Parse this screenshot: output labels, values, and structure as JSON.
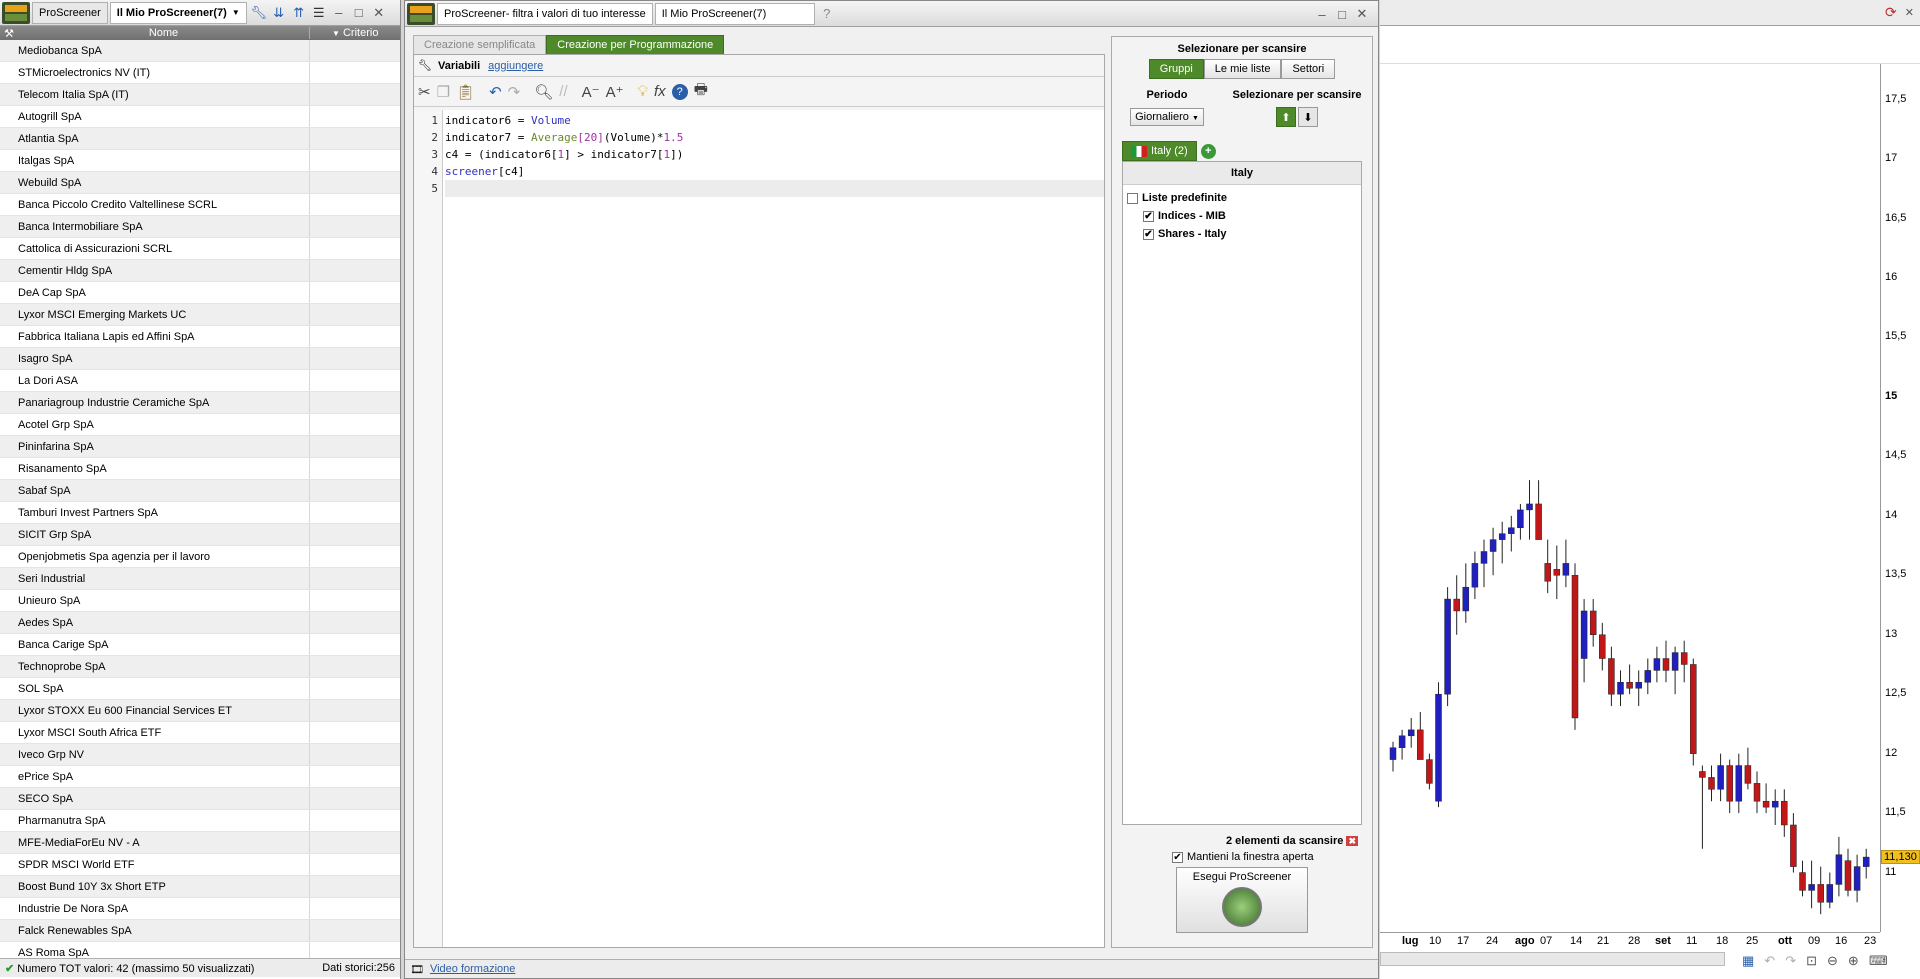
{
  "left_panel": {
    "tabs": [
      "ProScreener",
      "Il Mio ProScreener(7)"
    ],
    "columns": {
      "name": "Nome",
      "criterion": "Criterio"
    },
    "rows": [
      "Mediobanca SpA",
      "STMicroelectronics NV (IT)",
      "Telecom Italia SpA (IT)",
      "Autogrill SpA",
      "Atlantia SpA",
      "Italgas SpA",
      "Webuild SpA",
      "Banca Piccolo Credito Valtellinese SCRL",
      "Banca Intermobiliare SpA",
      "Cattolica di Assicurazioni SCRL",
      "Cementir Hldg SpA",
      "DeA Cap SpA",
      "Lyxor MSCI Emerging Markets UC",
      "Fabbrica Italiana Lapis ed Affini SpA",
      "Isagro SpA",
      "La Dori ASA",
      "Panariagroup Industrie Ceramiche SpA",
      "Acotel Grp SpA",
      "Pininfarina SpA",
      "Risanamento SpA",
      "Sabaf SpA",
      "Tamburi Invest Partners SpA",
      "SICIT Grp SpA",
      "Openjobmetis Spa agenzia per il lavoro",
      "Seri Industrial",
      "Unieuro SpA",
      "Aedes SpA",
      "Banca Carige SpA",
      "Technoprobe SpA",
      "SOL SpA",
      "Lyxor STOXX Eu 600 Financial Services ET",
      "Lyxor MSCI South Africa ETF",
      "Iveco Grp NV",
      "ePrice SpA",
      "SECO SpA",
      "Pharmanutra SpA",
      "MFE-MediaForEu NV - A",
      "SPDR MSCI World ETF",
      "Boost Bund 10Y 3x Short ETP",
      "Industrie De Nora SpA",
      "Falck Renewables SpA",
      "AS Roma SpA"
    ],
    "status_left": "Numero TOT valori: 42 (massimo 50 visualizzati)",
    "status_right": "Dati storici:256"
  },
  "window": {
    "tabs": [
      "ProScreener- filtra i valori di tuo interesse",
      "Il Mio ProScreener(7)"
    ],
    "mode_tabs": [
      "Creazione semplificata",
      "Creazione per Programmazione"
    ],
    "variables_label": "Variabili",
    "add_link": "aggiungere",
    "line_numbers": [
      "1",
      "2",
      "3",
      "4",
      "5"
    ],
    "video_link": "Video formazione"
  },
  "scan": {
    "title": "Selezionare per scansire",
    "tabs": [
      "Gruppi",
      "Le mie liste",
      "Settori"
    ],
    "period_label": "Periodo",
    "period_value": "Giornaliero",
    "sort_label": "Selezionare per scansire",
    "market_tab": "Italy (2)",
    "list_header": "Italy",
    "lists": [
      {
        "label": "Liste predefinite",
        "checked": false,
        "indent": 0
      },
      {
        "label": "Indices - MIB",
        "checked": true,
        "indent": 1
      },
      {
        "label": "Shares - Italy",
        "checked": true,
        "indent": 1
      }
    ],
    "count_text": "2 elementi da scansire",
    "keep_open": "Mantieni la finestra aperta",
    "run_button": "Esegui ProScreener"
  },
  "chart_data": {
    "type": "candlestick",
    "yticks": [
      "17,5",
      "17",
      "16,5",
      "16",
      "15,5",
      "15",
      "14,5",
      "14",
      "13,5",
      "13",
      "12,5",
      "12",
      "11,5",
      "11"
    ],
    "ylim": [
      10.5,
      17.8
    ],
    "xticks": [
      "lug",
      "10",
      "17",
      "24",
      "ago",
      "07",
      "14",
      "21",
      "28",
      "set",
      "11",
      "18",
      "25",
      "ott",
      "09",
      "16",
      "23"
    ],
    "last_price": "11,130",
    "colors": {
      "up": "#2020c0",
      "down": "#c01818"
    },
    "candles": [
      [
        11.95,
        12.1,
        11.85,
        12.05
      ],
      [
        12.05,
        12.2,
        11.95,
        12.15
      ],
      [
        12.15,
        12.3,
        12.05,
        12.2
      ],
      [
        12.2,
        12.35,
        12.1,
        11.95
      ],
      [
        11.95,
        12.0,
        11.7,
        11.75
      ],
      [
        11.6,
        12.6,
        11.55,
        12.5
      ],
      [
        12.5,
        13.4,
        12.4,
        13.3
      ],
      [
        13.3,
        13.5,
        13.0,
        13.2
      ],
      [
        13.2,
        13.6,
        13.1,
        13.4
      ],
      [
        13.4,
        13.7,
        13.3,
        13.6
      ],
      [
        13.6,
        13.8,
        13.4,
        13.7
      ],
      [
        13.7,
        13.9,
        13.5,
        13.8
      ],
      [
        13.8,
        13.95,
        13.6,
        13.85
      ],
      [
        13.85,
        14.0,
        13.7,
        13.9
      ],
      [
        13.9,
        14.1,
        13.8,
        14.05
      ],
      [
        14.05,
        14.3,
        13.8,
        14.1
      ],
      [
        14.1,
        14.3,
        13.9,
        13.8
      ],
      [
        13.6,
        13.8,
        13.35,
        13.45
      ],
      [
        13.55,
        13.75,
        13.3,
        13.5
      ],
      [
        13.5,
        13.8,
        13.4,
        13.6
      ],
      [
        13.5,
        13.6,
        12.2,
        12.3
      ],
      [
        12.8,
        13.3,
        12.6,
        13.2
      ],
      [
        13.2,
        13.3,
        12.9,
        13.0
      ],
      [
        13.0,
        13.1,
        12.7,
        12.8
      ],
      [
        12.8,
        12.9,
        12.4,
        12.5
      ],
      [
        12.5,
        12.7,
        12.4,
        12.6
      ],
      [
        12.6,
        12.75,
        12.5,
        12.55
      ],
      [
        12.55,
        12.7,
        12.4,
        12.6
      ],
      [
        12.6,
        12.8,
        12.5,
        12.7
      ],
      [
        12.7,
        12.9,
        12.6,
        12.8
      ],
      [
        12.8,
        12.95,
        12.6,
        12.7
      ],
      [
        12.7,
        12.9,
        12.5,
        12.85
      ],
      [
        12.85,
        12.95,
        12.6,
        12.75
      ],
      [
        12.75,
        12.8,
        11.9,
        12.0
      ],
      [
        11.85,
        11.9,
        11.2,
        11.8
      ],
      [
        11.8,
        11.9,
        11.6,
        11.7
      ],
      [
        11.7,
        12.0,
        11.6,
        11.9
      ],
      [
        11.9,
        11.95,
        11.5,
        11.6
      ],
      [
        11.6,
        12.0,
        11.5,
        11.9
      ],
      [
        11.9,
        12.05,
        11.7,
        11.75
      ],
      [
        11.75,
        11.85,
        11.5,
        11.6
      ],
      [
        11.6,
        11.75,
        11.5,
        11.55
      ],
      [
        11.55,
        11.7,
        11.4,
        11.6
      ],
      [
        11.6,
        11.7,
        11.3,
        11.4
      ],
      [
        11.4,
        11.5,
        11.0,
        11.05
      ],
      [
        11.0,
        11.1,
        10.8,
        10.85
      ],
      [
        10.85,
        11.1,
        10.7,
        10.9
      ],
      [
        10.9,
        11.05,
        10.65,
        10.75
      ],
      [
        10.75,
        11.0,
        10.7,
        10.9
      ],
      [
        10.9,
        11.3,
        10.8,
        11.15
      ],
      [
        11.1,
        11.2,
        10.8,
        10.85
      ],
      [
        10.85,
        11.15,
        10.75,
        11.05
      ],
      [
        11.05,
        11.2,
        10.95,
        11.13
      ]
    ]
  }
}
